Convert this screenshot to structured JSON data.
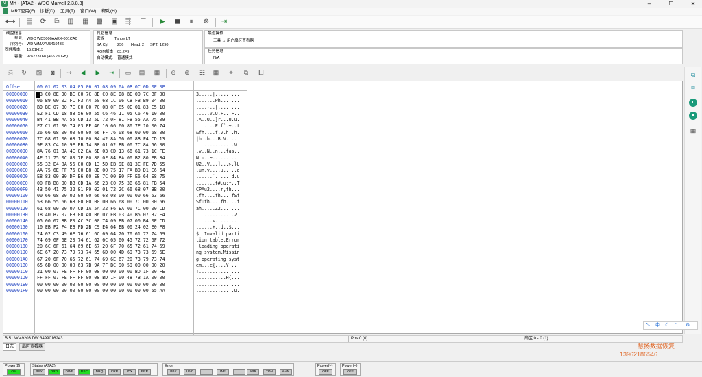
{
  "window": {
    "title": "Mrt - [ATA2 - WDC Marvell 2.3.8.3]",
    "controls": [
      "–",
      "☐",
      "✕"
    ]
  },
  "menu": [
    "MRT应用(F)",
    "诊断(D)",
    "工具(T)",
    "窗口(W)",
    "帮助(H)"
  ],
  "disk_info": {
    "title": "硬盘信息",
    "model_label": "型号:",
    "model": "WDC WD5000AAKX-001CA0",
    "serial_label": "序列号:",
    "serial": "WD-WMAYU5419436",
    "fw_label": "固件版本:",
    "fw": "15.01H15",
    "cap_label": "容量:",
    "cap": "976773168 (465.76 GB)"
  },
  "other_info": {
    "title": "其它信息",
    "family_label": "家族",
    "family": "Tahoe LT",
    "sacyl_label": "SA Cyl",
    "sacyl": "256",
    "head_label": "Head:",
    "head": "2",
    "spt_label": "SPT:",
    "spt": "1290",
    "rom_label": "ROM版本",
    "rom": "03.2F9",
    "boot_label": "启动模式:",
    "boot": "普通模式"
  },
  "recent_ops": {
    "title": "最近操作",
    "item": "工具 → 用户扇区查看器"
  },
  "task_info": {
    "title": "任务信息",
    "value": "N/A"
  },
  "hex": {
    "offset_header": "Offset",
    "col_header": "00 01 02 03 04 05 06 07 08 09 0A 0B 0C 0D 0E 0F",
    "rows": [
      {
        "o": "00000000",
        "h": "33 C0 8E D0 BC 00 7C 8E C0 8E D8 BE 00 7C BF 00",
        "a": "3.....|.....|..."
      },
      {
        "o": "00000010",
        "h": "06 B9 00 02 FC F3 A4 50 68 1C 06 CB FB B9 04 00",
        "a": ".......Ph......."
      },
      {
        "o": "00000020",
        "h": "BD BE 07 80 7E 00 00 7C 0B 0F 85 0E 01 83 C5 10",
        "a": "....~..|........"
      },
      {
        "o": "00000030",
        "h": "E2 F1 CD 18 88 56 00 55 C6 46 11 05 C6 46 10 00",
        "a": ".....V.U.F...F.."
      },
      {
        "o": "00000040",
        "h": "B4 41 BB AA 55 CD 13 5D 72 0F 81 FB 55 AA 75 09",
        "a": ".A..U..]r...U.u."
      },
      {
        "o": "00000050",
        "h": "F7 C1 01 00 74 03 FE 46 10 66 60 80 7E 10 00 74",
        "a": "....t..F.f`.~..t"
      },
      {
        "o": "00000060",
        "h": "26 66 68 00 00 00 00 66 FF 76 08 68 00 00 68 00",
        "a": "&fh....f.v.h..h."
      },
      {
        "o": "00000070",
        "h": "7C 68 01 00 68 10 00 B4 42 8A 56 00 8B F4 CD 13",
        "a": "|h..h...B.V....."
      },
      {
        "o": "00000080",
        "h": "9F 83 C4 10 9E EB 14 B8 01 02 BB 00 7C 8A 56 00",
        "a": "............|.V."
      },
      {
        "o": "00000090",
        "h": "8A 76 01 8A 4E 02 8A 6E 03 CD 13 66 61 73 1C FE",
        "a": ".v..N..n...fas.."
      },
      {
        "o": "000000A0",
        "h": "4E 11 75 0C 80 7E 00 80 0F 84 8A 00 B2 80 EB 84",
        "a": "N.u..~.........."
      },
      {
        "o": "000000B0",
        "h": "55 32 E4 8A 56 00 CD 13 5D EB 9E 81 3E FE 7D 55",
        "a": "U2..V...]...>.}U"
      },
      {
        "o": "000000C0",
        "h": "AA 75 6E FF 76 00 E8 8D 00 75 17 FA B0 D1 E6 64",
        "a": ".un.v....u.....d"
      },
      {
        "o": "000000D0",
        "h": "E8 83 00 B0 DF E6 60 E8 7C 00 B0 FF E6 64 E8 75",
        "a": "......`.|....d.u"
      },
      {
        "o": "000000E0",
        "h": "00 FB B8 00 BB CD 1A 66 23 C0 75 3B 66 81 FB 54",
        "a": ".......f#.u;f..T"
      },
      {
        "o": "000000F0",
        "h": "43 50 41 75 32 81 F9 02 01 72 2C 66 68 07 BB 00",
        "a": "CPAu2....r,fh..."
      },
      {
        "o": "00000100",
        "h": "00 66 68 00 02 00 00 66 68 08 00 00 00 66 53 66",
        "a": ".fh....fh....fSf"
      },
      {
        "o": "00000110",
        "h": "53 66 55 66 68 00 00 00 00 66 68 00 7C 00 00 66",
        "a": "SfUfh....fh.|..f"
      },
      {
        "o": "00000120",
        "h": "61 68 00 00 07 CD 1A 5A 32 F6 EA 00 7C 00 00 CD",
        "a": "ah.....Z2...|..."
      },
      {
        "o": "00000130",
        "h": "18 A0 B7 07 EB 08 A0 B6 07 EB 03 A0 B5 07 32 E4",
        "a": "..............2."
      },
      {
        "o": "00000140",
        "h": "05 00 07 8B F0 AC 3C 00 74 09 BB 07 00 B4 0E CD",
        "a": "......<.t......."
      },
      {
        "o": "00000150",
        "h": "10 EB F2 F4 EB FD 2B C9 E4 64 EB 00 24 02 E0 F8",
        "a": "......+..d..$..."
      },
      {
        "o": "00000160",
        "h": "24 02 C3 49 6E 76 61 6C 69 64 20 70 61 72 74 69",
        "a": "$..Invalid parti"
      },
      {
        "o": "00000170",
        "h": "74 69 6F 6E 20 74 61 62 6C 65 00 45 72 72 6F 72",
        "a": "tion table.Error"
      },
      {
        "o": "00000180",
        "h": "20 6C 6F 61 64 69 6E 67 20 6F 70 65 72 61 74 69",
        "a": " loading operati"
      },
      {
        "o": "00000190",
        "h": "6E 67 20 73 79 73 74 65 6D 00 4D 69 73 73 69 6E",
        "a": "ng system.Missin"
      },
      {
        "o": "000001A0",
        "h": "67 20 6F 70 65 72 61 74 69 6E 67 20 73 79 73 74",
        "a": "g operating syst"
      },
      {
        "o": "000001B0",
        "h": "65 6D 00 00 00 63 7B 9A 7F BC 90 59 00 00 00 20",
        "a": "em...c{....Y... "
      },
      {
        "o": "000001C0",
        "h": "21 00 07 FE FF FF 00 08 00 00 00 00 BD 1F 00 FE",
        "a": "!..............."
      },
      {
        "o": "000001D0",
        "h": "FF FF 07 FE FF FF 00 08 BD 1F 00 48 7B 1A 00 00",
        "a": "...........H{..."
      },
      {
        "o": "000001E0",
        "h": "00 00 00 00 00 00 00 00 00 00 00 00 00 00 00 00",
        "a": "................"
      },
      {
        "o": "000001F0",
        "h": "00 00 00 00 00 00 00 00 00 00 00 00 00 00 55 AA",
        "a": "..............U."
      }
    ]
  },
  "status": {
    "left": "B:51 W:49203 DW:3499016243",
    "pos": "Pos:0 (0)",
    "range": "扇区:0 - 0 (1)"
  },
  "tabs": [
    "日志",
    "扇区查看器"
  ],
  "ime": "中",
  "watermark": {
    "line1": "慧扬数据恢复",
    "line2": "13962186546"
  },
  "bottom": {
    "power2": {
      "label": "Power(2)",
      "led": "ON"
    },
    "status": {
      "label": "Status (ATA2)",
      "leds": [
        "BSY",
        "DRD",
        "DWF",
        "DSC",
        "DRQ",
        "CRR",
        "IDX",
        "ERR"
      ]
    },
    "error": {
      "label": "Error",
      "leds": [
        "BBK",
        "UNC",
        "",
        "INF",
        "",
        "ABR",
        "TON",
        "AMN"
      ]
    },
    "powerA": {
      "label": "Power(−)",
      "led": "OFF"
    },
    "powerB": {
      "label": "Power(−)",
      "led": "OFF"
    }
  }
}
